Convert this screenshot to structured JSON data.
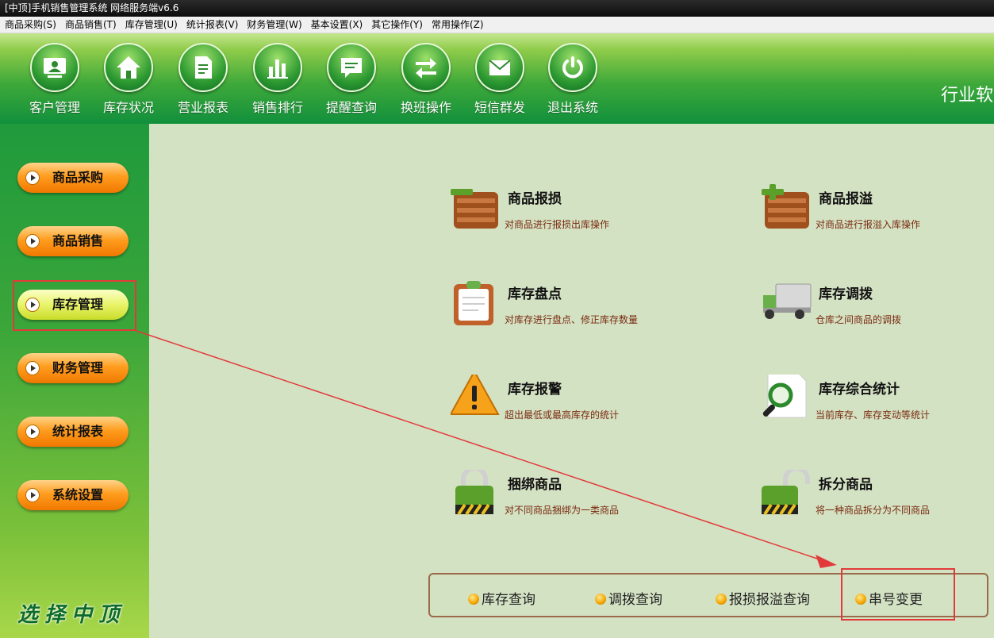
{
  "window": {
    "title": "[中顶]手机销售管理系统 网络服务端v6.6"
  },
  "menu": [
    "商品采购(S)",
    "商品销售(T)",
    "库存管理(U)",
    "统计报表(V)",
    "财务管理(W)",
    "基本设置(X)",
    "其它操作(Y)",
    "常用操作(Z)"
  ],
  "toolbar": {
    "items": [
      {
        "label": "客户管理",
        "icon": "customer-icon"
      },
      {
        "label": "库存状况",
        "icon": "home-icon"
      },
      {
        "label": "营业报表",
        "icon": "report-icon"
      },
      {
        "label": "销售排行",
        "icon": "bar-chart-icon"
      },
      {
        "label": "提醒查询",
        "icon": "message-icon"
      },
      {
        "label": "换班操作",
        "icon": "swap-icon"
      },
      {
        "label": "短信群发",
        "icon": "mail-icon"
      },
      {
        "label": "退出系统",
        "icon": "power-icon"
      }
    ],
    "brand_text": "行业软"
  },
  "sidebar": {
    "items": [
      "商品采购",
      "商品销售",
      "库存管理",
      "财务管理",
      "统计报表",
      "系统设置"
    ],
    "active": "库存管理",
    "brand": "选择中顶"
  },
  "features": [
    {
      "title": "商品报损",
      "desc": "对商品进行报损出库操作",
      "icon": "box-minus-icon"
    },
    {
      "title": "商品报溢",
      "desc": "对商品进行报溢入库操作",
      "icon": "box-plus-icon"
    },
    {
      "title": "库存盘点",
      "desc": "对库存进行盘点、修正库存数量",
      "icon": "clipboard-icon"
    },
    {
      "title": "库存调拨",
      "desc": "仓库之间商品的调拨",
      "icon": "truck-icon"
    },
    {
      "title": "库存报警",
      "desc": "超出最低或最高库存的统计",
      "icon": "warning-icon"
    },
    {
      "title": "库存综合统计",
      "desc": "当前库存、库存变动等统计",
      "icon": "magnifier-icon"
    },
    {
      "title": "捆绑商品",
      "desc": "对不同商品捆绑为一类商品",
      "icon": "lock-closed-icon"
    },
    {
      "title": "拆分商品",
      "desc": "将一种商品拆分为不同商品",
      "icon": "lock-open-icon"
    }
  ],
  "quick": [
    "库存查询",
    "调拨查询",
    "报损报溢查询",
    "串号变更"
  ],
  "colors": {
    "highlight": "#e23a3a",
    "accent_orange": "#f07800",
    "green_dark": "#11903c"
  }
}
